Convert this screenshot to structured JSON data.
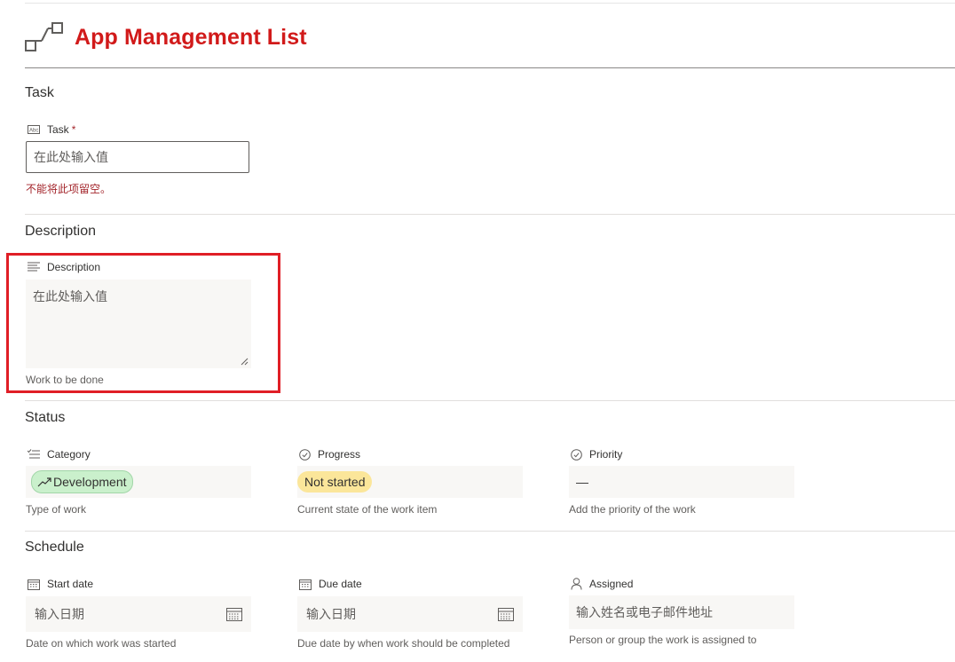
{
  "header": {
    "title": "App Management List",
    "icon": "flow-icon"
  },
  "sections": {
    "task": "Task",
    "description": "Description",
    "status": "Status",
    "schedule": "Schedule"
  },
  "task_field": {
    "label": "Task",
    "required_marker": "*",
    "placeholder": "在此处输入值",
    "error": "不能将此项留空。"
  },
  "description_field": {
    "label": "Description",
    "placeholder": "在此处输入值",
    "hint": "Work to be done"
  },
  "category": {
    "label": "Category",
    "value": "Development",
    "hint": "Type of work"
  },
  "progress": {
    "label": "Progress",
    "value": "Not started",
    "hint": "Current state of the work item"
  },
  "priority": {
    "label": "Priority",
    "value": "—",
    "hint": "Add the priority of the work"
  },
  "start_date": {
    "label": "Start date",
    "placeholder": "输入日期",
    "hint": "Date on which work was started"
  },
  "due_date": {
    "label": "Due date",
    "placeholder": "输入日期",
    "hint": "Due date by when work should be completed"
  },
  "assigned": {
    "label": "Assigned",
    "placeholder": "输入姓名或电子邮件地址",
    "hint": "Person or group the work is assigned to"
  },
  "colors": {
    "title": "#d11a1a",
    "highlight": "#e01e26",
    "error": "#a4262c"
  }
}
